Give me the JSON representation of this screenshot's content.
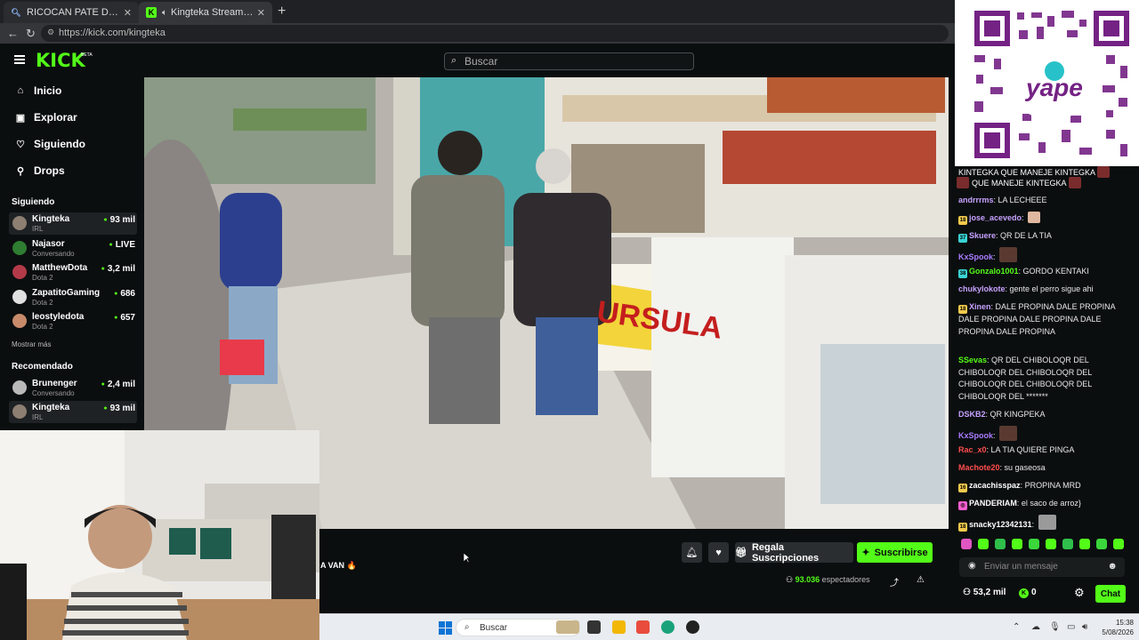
{
  "browser": {
    "tabs": [
      {
        "title": "RICOCAN PATE DE POLLO - Búsque",
        "close": "✕"
      },
      {
        "title": "Kingteka Stream - Watch Live",
        "close": "✕"
      }
    ],
    "new_tab": "+",
    "url": "https://kick.com/kingteka"
  },
  "header": {
    "logo": "KICK",
    "beta": "BETA",
    "search_placeholder": "Buscar"
  },
  "sidebar": {
    "nav": [
      {
        "label": "Inicio",
        "icon": "home-icon"
      },
      {
        "label": "Explorar",
        "icon": "explore-icon"
      },
      {
        "label": "Siguiendo",
        "icon": "heart-icon"
      },
      {
        "label": "Drops",
        "icon": "drops-icon"
      }
    ],
    "following_header": "Siguiendo",
    "following": [
      {
        "name": "Kingteka",
        "category": "IRL",
        "viewers": "93 mil",
        "color": "#8d7f72"
      },
      {
        "name": "Najasor",
        "category": "Conversando",
        "viewers": "LIVE",
        "color": "#2e7d32"
      },
      {
        "name": "MatthewDota",
        "category": "Dota 2",
        "viewers": "3,2 mil",
        "color": "#b23a48"
      },
      {
        "name": "ZapatitoGaming",
        "category": "Dota 2",
        "viewers": "686",
        "color": "#e0e0e0"
      },
      {
        "name": "leostyledota",
        "category": "Dota 2",
        "viewers": "657",
        "color": "#c78a6b"
      }
    ],
    "show_more": "Mostrar más",
    "recommended_header": "Recomendado",
    "recommended": [
      {
        "name": "Brunenger",
        "category": "Conversando",
        "viewers": "2,4 mil",
        "color": "#b9b9b9"
      },
      {
        "name": "Kingteka",
        "category": "IRL",
        "viewers": "93 mil",
        "color": "#8d7f72"
      }
    ]
  },
  "player": {
    "title_fragment": "A VAN 🔥",
    "gift_label": "Regala Suscripciones",
    "subscribe_label": "Suscribirse",
    "viewers_count": "93.036",
    "viewers_label": "espectadores"
  },
  "chat": {
    "messages": [
      {
        "user": "",
        "text": "KINTEGKA  QUE MANEJE KINTEGKA",
        "color": "#ffffff"
      },
      {
        "user": "",
        "text": "QUE MANEJE KINTEGKA",
        "color": "#ffffff"
      },
      {
        "user": "andrrrms",
        "text": "LA LECHEEE",
        "color": "#c7a2ff",
        "badge": ""
      },
      {
        "user": "jose_acevedo",
        "text": "",
        "color": "#c7a2ff",
        "badge": "18",
        "badge_color": "#f2c94c",
        "emote": true
      },
      {
        "user": "Skuere",
        "text": "QR DE LA TIA",
        "color": "#c7a2ff",
        "badge": "37",
        "badge_color": "#3ad4d4"
      },
      {
        "user": "KxSpook",
        "text": "",
        "color": "#a97cff",
        "badge": "",
        "emote": "big"
      },
      {
        "user": "Gonzalo1001",
        "text": "GORDO KENTAKI",
        "color": "#53fc18",
        "badge": "38",
        "badge_color": "#3ad4d4"
      },
      {
        "user": "chukylokote",
        "text": "gente el perro sigue ahi",
        "color": "#c7a2ff",
        "badge": ""
      },
      {
        "user": "Xinen",
        "text": "DALE PROPINA  DALE PROPINA  DALE PROPINA  DALE PROPINA  DALE PROPINA  DALE PROPINA",
        "color": "#c7a2ff",
        "badge": "18",
        "badge_color": "#f2c94c"
      },
      {
        "user": "SSevas",
        "text": "QR DEL CHIBOLOQR DEL CHIBOLOQR DEL CHIBOLOQR DEL CHIBOLOQR DEL CHIBOLOQR DEL CHIBOLOQR DEL *******",
        "color": "#53fc18",
        "badge": ""
      },
      {
        "user": "DSKB2",
        "text": "QR KINGPEKA",
        "color": "#c7a2ff",
        "badge": ""
      },
      {
        "user": "KxSpook",
        "text": "",
        "color": "#a97cff",
        "badge": "",
        "emote": "big"
      },
      {
        "user": "Rac_x0",
        "text": "LA TIA QUIERE PINGA",
        "color": "#ff4d4d",
        "badge": ""
      },
      {
        "user": "Machote20",
        "text": "su gaseosa",
        "color": "#ff4d4d",
        "badge": ""
      },
      {
        "user": "zacachisspaz",
        "text": "PROPINA MRD",
        "color": "#ffffff",
        "badge": "16",
        "badge_color": "#f2c94c"
      },
      {
        "user": "PANDERIAM",
        "text": "el saco de arroz}",
        "color": "#ffffff",
        "badge": "◎",
        "badge_color": "#ff5fd2"
      },
      {
        "user": "snacky12342131",
        "text": "",
        "color": "#ffffff",
        "badge": "18",
        "badge_color": "#f2c94c",
        "emote": "big"
      }
    ],
    "input_placeholder": "Enviar un mensaje",
    "viewers_short": "53,2 mil",
    "kicks": "0",
    "chat_button": "Chat"
  },
  "taskbar": {
    "search": "Buscar",
    "time": "15:38",
    "date": "5/08/2026"
  },
  "colors": {
    "brand_green": "#53fc18",
    "background": "#0b0e0f"
  }
}
